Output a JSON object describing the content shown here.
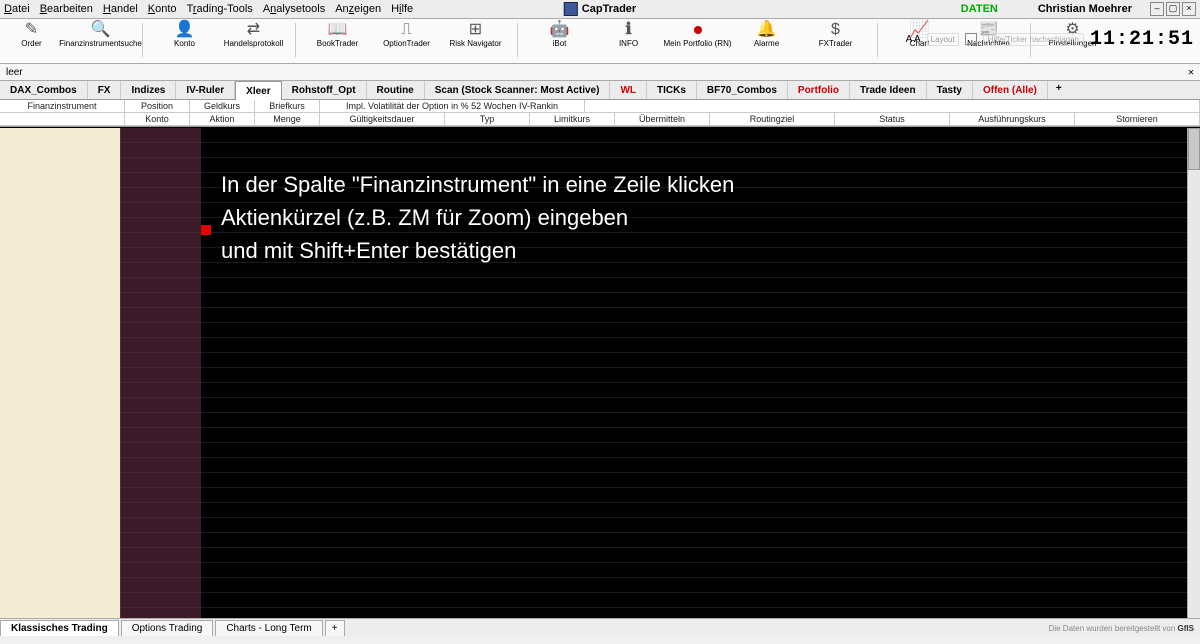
{
  "app": {
    "title": "CapTrader",
    "data_status": "DATEN",
    "user": "Christian Moehrer",
    "clock": "11:21:51"
  },
  "menu": [
    "Datei",
    "Bearbeiten",
    "Handel",
    "Konto",
    "Trading-Tools",
    "Analysetools",
    "Anzeigen",
    "Hilfe"
  ],
  "toolbar": {
    "aa": "A A",
    "layout_hint": "Layout",
    "search_hint": "Hilfe/Ticker nachschlagen",
    "buttons": [
      {
        "glyph": "✎",
        "label": "Order"
      },
      {
        "glyph": "🔍",
        "label": "Finanzinstrumentsuche"
      },
      {
        "glyph": "👤",
        "label": "Konto"
      },
      {
        "glyph": "⇄",
        "label": "Handelsprotokoll"
      },
      {
        "glyph": "📖",
        "label": "BookTrader"
      },
      {
        "glyph": "⎍",
        "label": "OptionTrader"
      },
      {
        "glyph": "⊞",
        "label": "Risk Navigator"
      },
      {
        "glyph": "🤖",
        "label": "iBot"
      },
      {
        "glyph": "ℹ",
        "label": "INFO"
      },
      {
        "glyph": "●",
        "label": "Mein Portfolio (RN)"
      },
      {
        "glyph": "🔔",
        "label": "Alarme"
      },
      {
        "glyph": "$",
        "label": "FXTrader"
      },
      {
        "glyph": "📈",
        "label": "Chart"
      },
      {
        "glyph": "📰",
        "label": "Nachrichten"
      },
      {
        "glyph": "⚙",
        "label": "Einstellungen"
      }
    ]
  },
  "subbar": {
    "label": "leer"
  },
  "tabs": [
    {
      "label": "DAX_Combos"
    },
    {
      "label": "FX"
    },
    {
      "label": "Indizes"
    },
    {
      "label": "IV-Ruler"
    },
    {
      "label": "Xleer",
      "active": true
    },
    {
      "label": "Rohstoff_Opt"
    },
    {
      "label": "Routine"
    },
    {
      "label": "Scan (Stock Scanner: Most Active)"
    },
    {
      "label": "WL",
      "red": true
    },
    {
      "label": "TICKs"
    },
    {
      "label": "BF70_Combos"
    },
    {
      "label": "Portfolio",
      "red": true
    },
    {
      "label": "Trade Ideen"
    },
    {
      "label": "Tasty"
    },
    {
      "label": "Offen (Alle)",
      "red": true
    }
  ],
  "plus": "+",
  "header_row1": {
    "c0": "Finanzinstrument",
    "c1": "Position",
    "c2": "Geldkurs",
    "c3": "Briefkurs",
    "c4": "Impl. Volatilität der Option in % 52 Wochen IV-Rankin"
  },
  "header_row2": {
    "c1": "Konto",
    "c2": "Aktion",
    "c3": "Menge",
    "c4": "Gültigkeitsdauer",
    "c5": "Typ",
    "c6": "Limitkurs",
    "c7": "Übermitteln",
    "c8": "Routingziel",
    "c9": "Status",
    "c10": "Ausführungskurs",
    "c11": "Stornieren"
  },
  "overlay": {
    "l1": "In der Spalte \"Finanzinstrument\" in eine Zeile klicken",
    "l2": "Aktienkürzel (z.B. ZM für Zoom) eingeben",
    "l3": "und mit Shift+Enter bestätigen"
  },
  "bottom_tabs": [
    {
      "label": "Klassisches Trading",
      "active": true
    },
    {
      "label": "Options Trading"
    },
    {
      "label": "Charts - Long Term"
    }
  ],
  "footer_credit": {
    "prefix": "Die Daten wurden bereitgestellt von ",
    "brand": "GfIS"
  }
}
